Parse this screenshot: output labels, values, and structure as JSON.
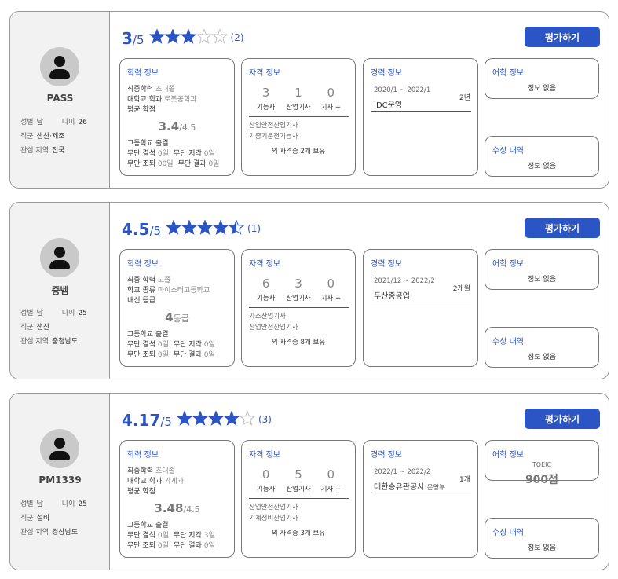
{
  "labels": {
    "rate_button": "평가하기",
    "edu_title": "학력 정보",
    "cert_title": "자격 정보",
    "career_title": "경력 정보",
    "lang_title": "어학 정보",
    "award_title": "수상 내역",
    "no_info": "정보 없음",
    "cert_cats": [
      "기능사",
      "산업기사",
      "기사 +"
    ],
    "gender_key": "성별",
    "age_key": "나이",
    "job_key": "직군",
    "region_key": "관심 지역",
    "absent_key": "무단 결석",
    "late_key": "무단 지각",
    "early_key": "무단 조퇴",
    "result_key": "무단 결과"
  },
  "colors": {
    "accent": "#2b55c5",
    "star": "#2b55c5",
    "star_empty": "#bfbfbf"
  },
  "cards": [
    {
      "name": "PASS",
      "gender": "남",
      "age": "26",
      "job": "생산·제조",
      "region": "전국",
      "score": "3",
      "score_max": "/5",
      "rating": 3,
      "review_count": "(2)",
      "edu": {
        "line1_key": "최종학력",
        "line1_val": "초대졸",
        "line2_key": "대학교 학과",
        "line2_val": "로봇공학과",
        "line3_key": "평균 학점",
        "gpa": "3.4",
        "gpa_max": "/4.5",
        "school": "고등학교 출결",
        "absent": "0일",
        "late": "0일",
        "early": "00일",
        "result": "0일"
      },
      "cert": {
        "counts": [
          "3",
          "1",
          "0"
        ],
        "list": [
          "산업안전산업기사",
          "기중기운전기능사"
        ],
        "more": "외 자격증 2개 보유"
      },
      "career": {
        "period": "2020/1 ~ 2022/1",
        "company": "IDC운영",
        "role": "",
        "duration": "2년"
      },
      "lang": {
        "type": "",
        "score": ""
      }
    },
    {
      "name": "중벰",
      "gender": "남",
      "age": "25",
      "job": "생산",
      "region": "충청남도",
      "score": "4.5",
      "score_max": "/5",
      "rating": 4.5,
      "review_count": "(1)",
      "edu": {
        "line1_key": "최종 학력",
        "line1_val": "고졸",
        "line2_key": "학교 종류",
        "line2_val": "마이스터고등학교",
        "line3_key": "내신 등급",
        "gpa": "4",
        "gpa_max": "등급",
        "school": "고등학교 출결",
        "absent": "0일",
        "late": "0일",
        "early": "0일",
        "result": "0일"
      },
      "cert": {
        "counts": [
          "6",
          "3",
          "0"
        ],
        "list": [
          "가스산업기사",
          "산업안전산업기사"
        ],
        "more": "외 자격증 8개 보유"
      },
      "career": {
        "period": "2021/12 ~ 2022/2",
        "company": "두산중공업",
        "role": "",
        "duration": "2개월"
      },
      "lang": {
        "type": "",
        "score": ""
      }
    },
    {
      "name": "PM1339",
      "gender": "남",
      "age": "25",
      "job": "설비",
      "region": "경상남도",
      "score": "4.17",
      "score_max": "/5",
      "rating": 4,
      "review_count": "(3)",
      "edu": {
        "line1_key": "최종학력",
        "line1_val": "초대졸",
        "line2_key": "대학교 학과",
        "line2_val": "기계과",
        "line3_key": "평균 학점",
        "gpa": "3.48",
        "gpa_max": "/4.5",
        "school": "고등학교 출결",
        "absent": "0일",
        "late": "3일",
        "early": "0일",
        "result": "0일"
      },
      "cert": {
        "counts": [
          "0",
          "5",
          "0"
        ],
        "list": [
          "산업안전산업기사",
          "기계정비산업기사"
        ],
        "more": "외 자격증 3개 보유"
      },
      "career": {
        "period": "2022/1 ~ 2022/2",
        "company": "대한송유관공사",
        "role": "운영부",
        "duration": "1개"
      },
      "lang": {
        "type": "TOEIC",
        "score": "900점"
      }
    }
  ]
}
